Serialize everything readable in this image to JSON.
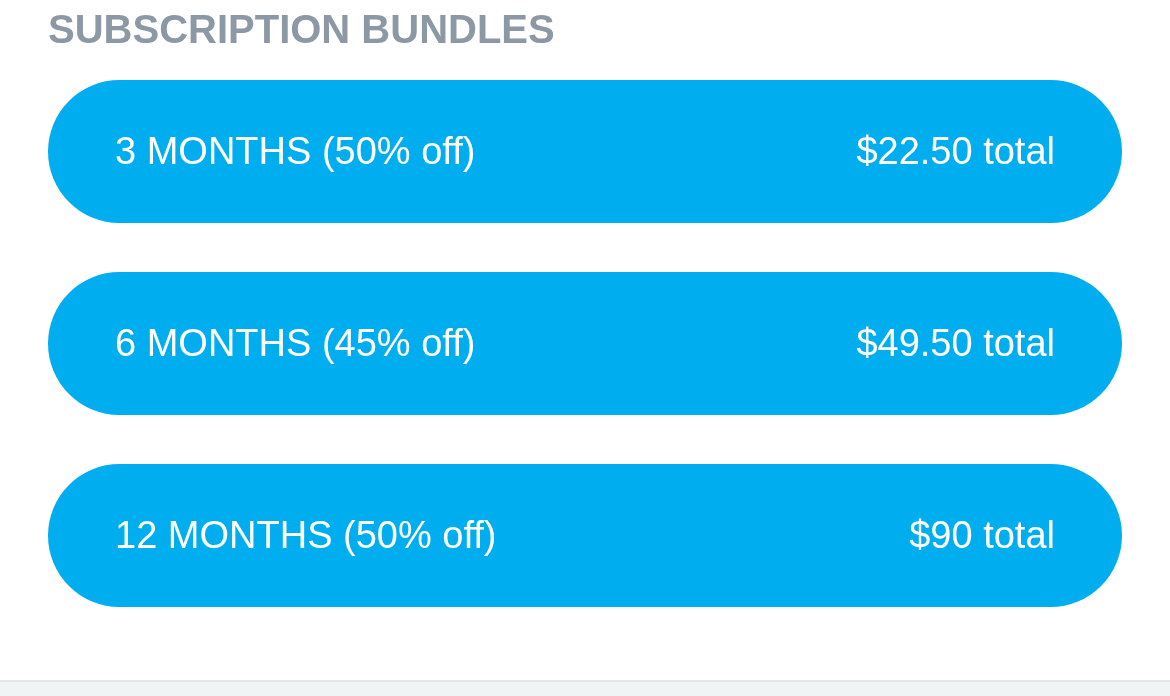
{
  "title": "SUBSCRIPTION BUNDLES",
  "bundles": [
    {
      "label": "3 MONTHS (50% off)",
      "price": "$22.50 total"
    },
    {
      "label": "6 MONTHS (45% off)",
      "price": "$49.50 total"
    },
    {
      "label": "12 MONTHS (50% off)",
      "price": "$90 total"
    }
  ]
}
